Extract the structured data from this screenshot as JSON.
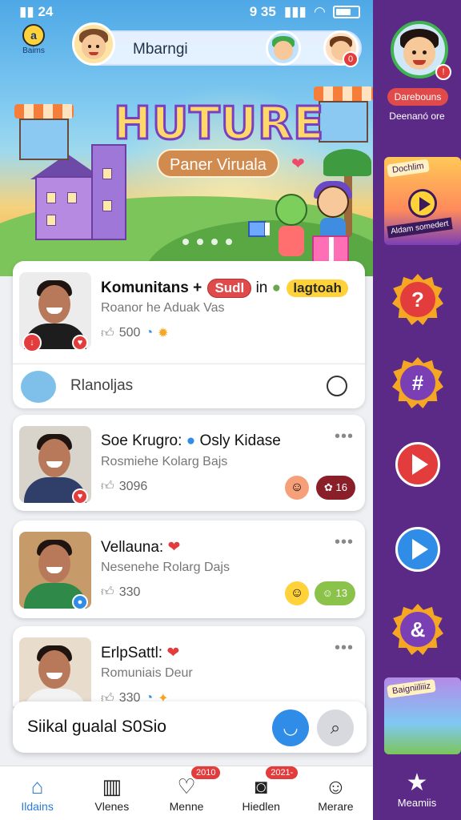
{
  "status_bar": {
    "left": "24",
    "right": "9 35"
  },
  "header": {
    "logo_label": "Baims",
    "logo_small": "a",
    "search_text": "Mbarngi",
    "avatar_badge": "0"
  },
  "hero": {
    "title": "HUTURE",
    "subtitle": "Paner Viruala",
    "page_dots": 4
  },
  "feed": {
    "card1": {
      "title": "Komunitans",
      "title_sep": "+",
      "tag1": "Sudl",
      "title_in": "in",
      "tag2": "lagtoah",
      "subtitle": "Roanor he Aduak Vas",
      "meta": "500"
    },
    "card1_sub": {
      "text": "Rlanoljas"
    },
    "card2": {
      "title": "Soe Krugro:",
      "title_tail": "Osly Kidase",
      "subtitle": "Rosmiehe Kolarg Bajs",
      "meta": "3096",
      "badge_text": "16",
      "more": "•••"
    },
    "card3": {
      "title": "Vellauna:",
      "subtitle": "Nesenehe Rolarg Dajs",
      "meta": "330",
      "badge_text": "13",
      "more": "•••"
    },
    "card4": {
      "title": "ErlpSattl:",
      "subtitle": "Romuniais Deur",
      "meta": "330",
      "more": "•••"
    }
  },
  "compose": {
    "text": "Siikal gualal S0Sio"
  },
  "bottom_nav": [
    {
      "label": "Ildains",
      "icon": "home-icon",
      "badge": ""
    },
    {
      "label": "Vlenes",
      "icon": "building-icon",
      "badge": ""
    },
    {
      "label": "Menne",
      "icon": "heart-chat-icon",
      "badge": "2010"
    },
    {
      "label": "Hiedlen",
      "icon": "camera-icon",
      "badge": "2021-"
    },
    {
      "label": "Merare",
      "icon": "profile-icon",
      "badge": ""
    }
  ],
  "rail": {
    "profile_pill": "Darebouns",
    "profile_caption": "Deenanó ore",
    "card1_label": "Dochlim",
    "card1_label2": "Aldam somedert",
    "card2_label": "Baigniiliiiz",
    "bottom_label": "Meamiis"
  },
  "colors": {
    "accent": "#2b7bd6",
    "rail_bg": "#5a2a86",
    "badge_red": "#e33c3c"
  }
}
